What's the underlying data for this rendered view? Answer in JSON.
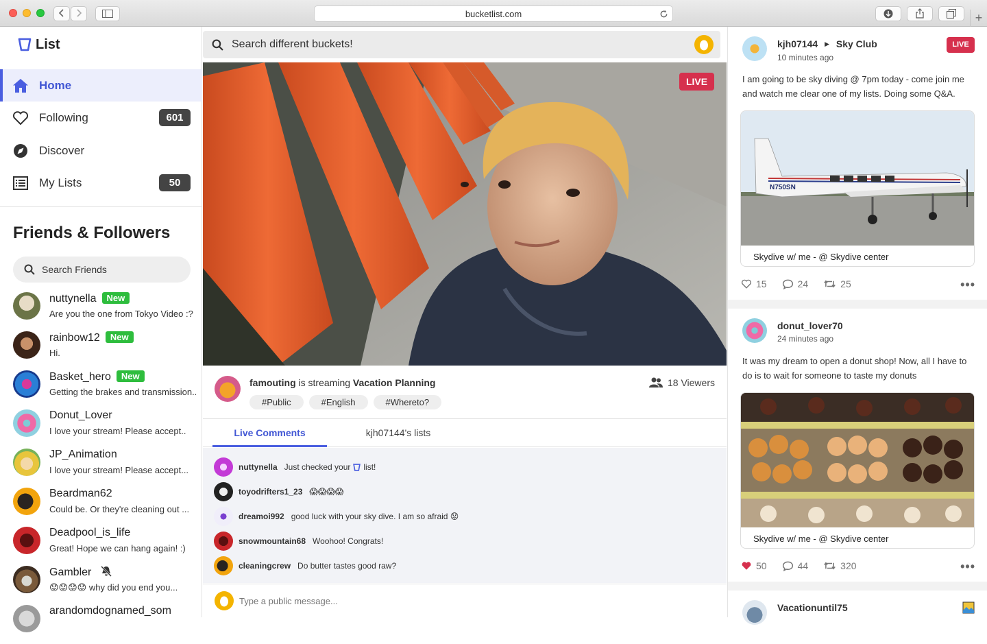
{
  "browser": {
    "url": "bucketlist.com"
  },
  "app": {
    "logo_text": "List",
    "accent": "#4a5ee0",
    "live_color": "#d6304d",
    "new_badge_color": "#2ebd3d"
  },
  "nav": {
    "items": [
      {
        "label": "Home",
        "icon": "home-icon",
        "active": true
      },
      {
        "label": "Following",
        "icon": "heart-icon",
        "count": "601"
      },
      {
        "label": "Discover",
        "icon": "compass-icon"
      },
      {
        "label": "My Lists",
        "icon": "list-icon",
        "count": "50"
      }
    ]
  },
  "friends": {
    "title": "Friends & Followers",
    "search_placeholder": "Search Friends",
    "new_label": "New",
    "list": [
      {
        "name": "nuttynella",
        "message": "Are you the one from Tokyo Video :?",
        "new": true
      },
      {
        "name": "rainbow12",
        "message": "Hi.",
        "new": true
      },
      {
        "name": "Basket_hero",
        "message": "Getting the brakes and transmission...",
        "new": true
      },
      {
        "name": "Donut_Lover",
        "message": "I love your stream! Please accept.."
      },
      {
        "name": "JP_Animation",
        "message": "I love your stream! Please accept..."
      },
      {
        "name": "Beardman62",
        "message": "Could be. Or they're cleaning out ..."
      },
      {
        "name": "Deadpool_is_life",
        "message": "Great! Hope we can hang again! :)"
      },
      {
        "name": "Gambler",
        "message": "😟😟😟😟 why did you end you...",
        "muted": true
      },
      {
        "name": "arandomdognamed_som",
        "message": ""
      }
    ]
  },
  "main": {
    "search_placeholder": "Search different buckets!",
    "live_label": "LIVE",
    "stream": {
      "streamer": "famouting",
      "streaming_text": "is streaming",
      "title": "Vacation Planning",
      "viewers": "18 Viewers",
      "tags": [
        "#Public",
        "#English",
        "#Whereto?"
      ]
    },
    "tabs": [
      {
        "label": "Live Comments",
        "active": true
      },
      {
        "label": "kjh07144's lists"
      }
    ],
    "comments": [
      {
        "user": "nuttynella",
        "text": "Just checked your",
        "suffix": "list!"
      },
      {
        "user": "toyodrifters1_23",
        "text": "😱😱😱😱"
      },
      {
        "user": "dreamoi992",
        "text": "good luck with your sky dive. I am so afraid 😟"
      },
      {
        "user": "snowmountain68",
        "text": "Woohoo! Congrats!"
      },
      {
        "user": "cleaningcrew",
        "text": "Do butter tastes good raw?"
      }
    ],
    "message_placeholder": "Type a public message..."
  },
  "feed": {
    "posts": [
      {
        "user": "kjh07144",
        "place": "Sky Club",
        "time": "10 minutes ago",
        "live": "LIVE",
        "text": "I am going to be sky diving @ 7pm today - come join me and watch me clear one of my lists. Doing some Q&A.",
        "image_text": "N750SN",
        "caption": "Skydive w/ me - @ Skydive center",
        "likes": "15",
        "comments": "24",
        "reposts": "25"
      },
      {
        "user": "donut_lover70",
        "time": "24 minutes ago",
        "text": "It was my dream to open a donut shop! Now, all I have to do is to wait for someone to taste my donuts",
        "caption": "Skydive w/ me - @ Skydive center",
        "likes": "50",
        "comments": "44",
        "reposts": "320",
        "liked": true
      },
      {
        "user": "Vacationuntil75"
      }
    ]
  }
}
